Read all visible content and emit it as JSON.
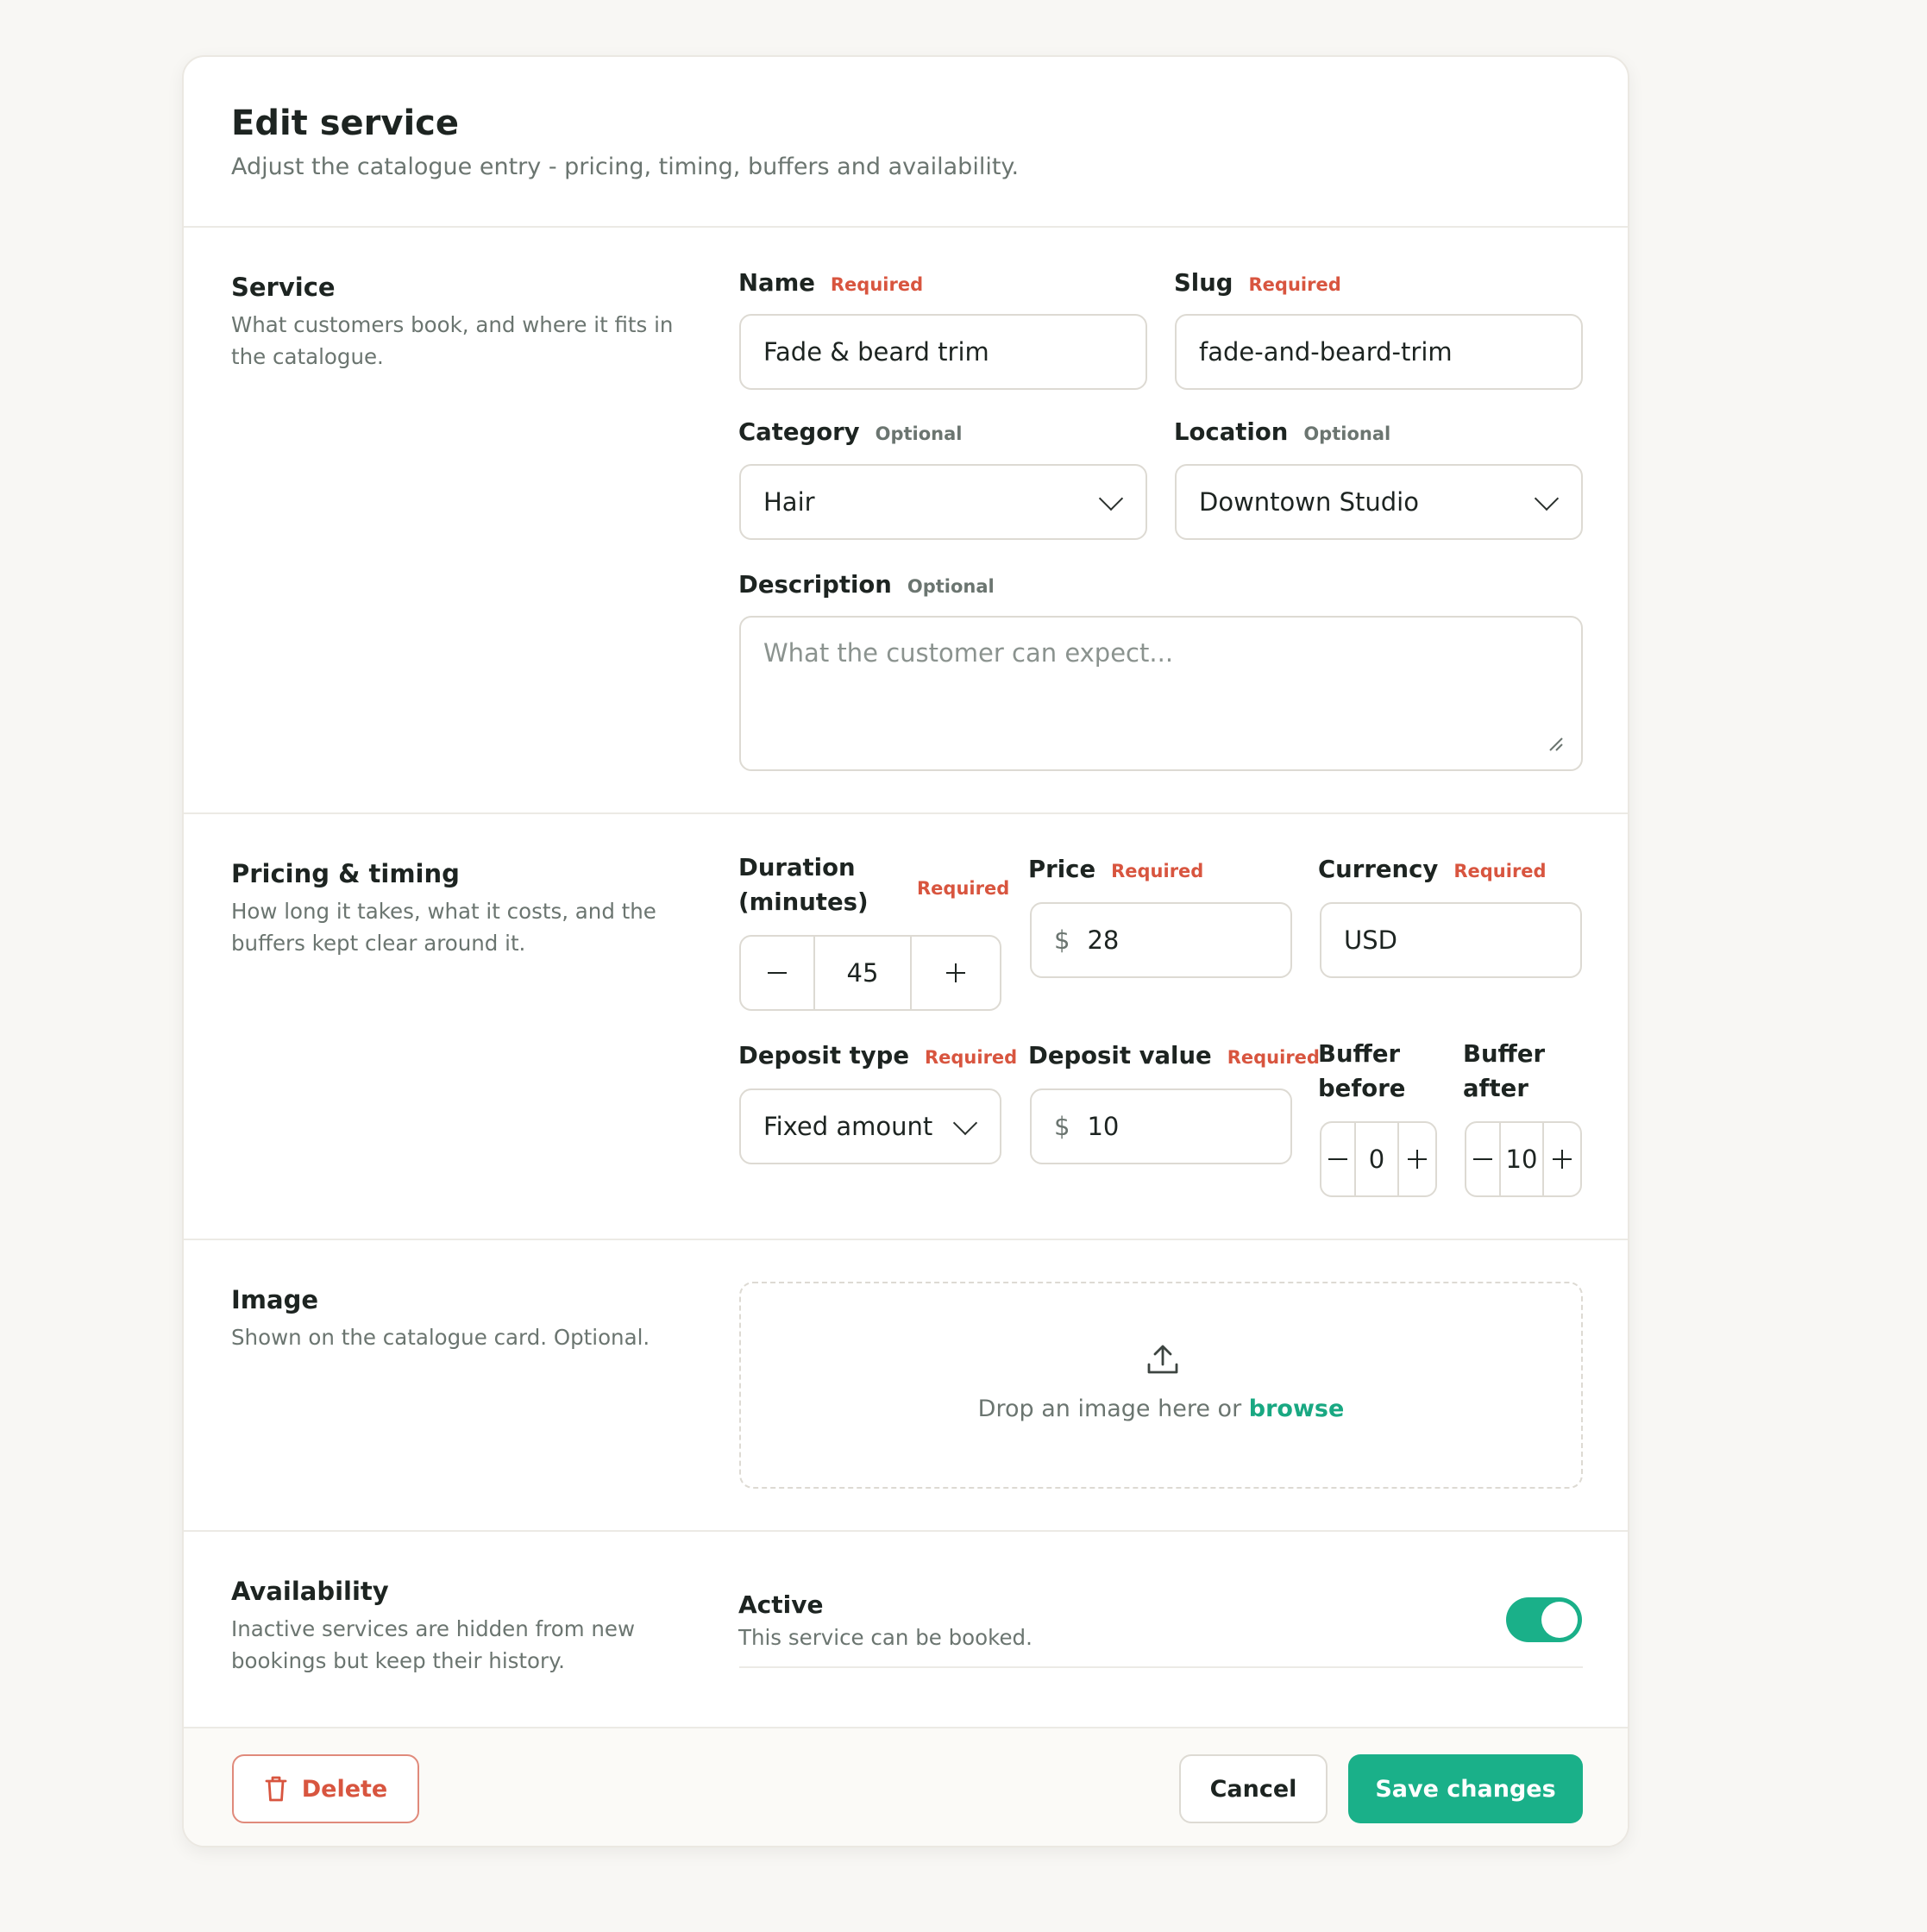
{
  "header": {
    "title": "Edit service",
    "subtitle": "Adjust the catalogue entry - pricing, timing, buffers and availability."
  },
  "service": {
    "title": "Service",
    "desc": "What customers book, and where it fits in the catalogue.",
    "name": {
      "label": "Name",
      "tag": "Required",
      "value": "Fade & beard trim"
    },
    "slug": {
      "label": "Slug",
      "tag": "Required",
      "value": "fade-and-beard-trim"
    },
    "category": {
      "label": "Category",
      "tag": "Optional",
      "value": "Hair"
    },
    "location": {
      "label": "Location",
      "tag": "Optional",
      "value": "Downtown Studio"
    },
    "description": {
      "label": "Description",
      "tag": "Optional",
      "placeholder": "What the customer can expect..."
    }
  },
  "pricing": {
    "title": "Pricing & timing",
    "desc": "How long it takes, what it costs, and the buffers kept clear around it.",
    "duration": {
      "label": "Duration (minutes)",
      "tag": "Required",
      "value": "45"
    },
    "price": {
      "label": "Price",
      "tag": "Required",
      "prefix": "$",
      "value": "28"
    },
    "currency": {
      "label": "Currency",
      "tag": "Required",
      "value": "USD"
    },
    "deposit_type": {
      "label": "Deposit type",
      "tag": "Required",
      "value": "Fixed amount"
    },
    "deposit_value": {
      "label": "Deposit value",
      "tag": "Required",
      "prefix": "$",
      "value": "10"
    },
    "buffer_before": {
      "label": "Buffer before",
      "value": "0"
    },
    "buffer_after": {
      "label": "Buffer after",
      "value": "10"
    }
  },
  "image": {
    "title": "Image",
    "desc": "Shown on the catalogue card. Optional.",
    "drop_text": "Drop an image here or",
    "browse": "browse"
  },
  "availability": {
    "title": "Availability",
    "desc": "Inactive services are hidden from new bookings but keep their history.",
    "active_label": "Active",
    "active_desc": "This service can be booked.",
    "active": true
  },
  "footer": {
    "delete": "Delete",
    "cancel": "Cancel",
    "save": "Save changes"
  },
  "colors": {
    "accent": "#1ab089",
    "danger": "#d8553f"
  }
}
